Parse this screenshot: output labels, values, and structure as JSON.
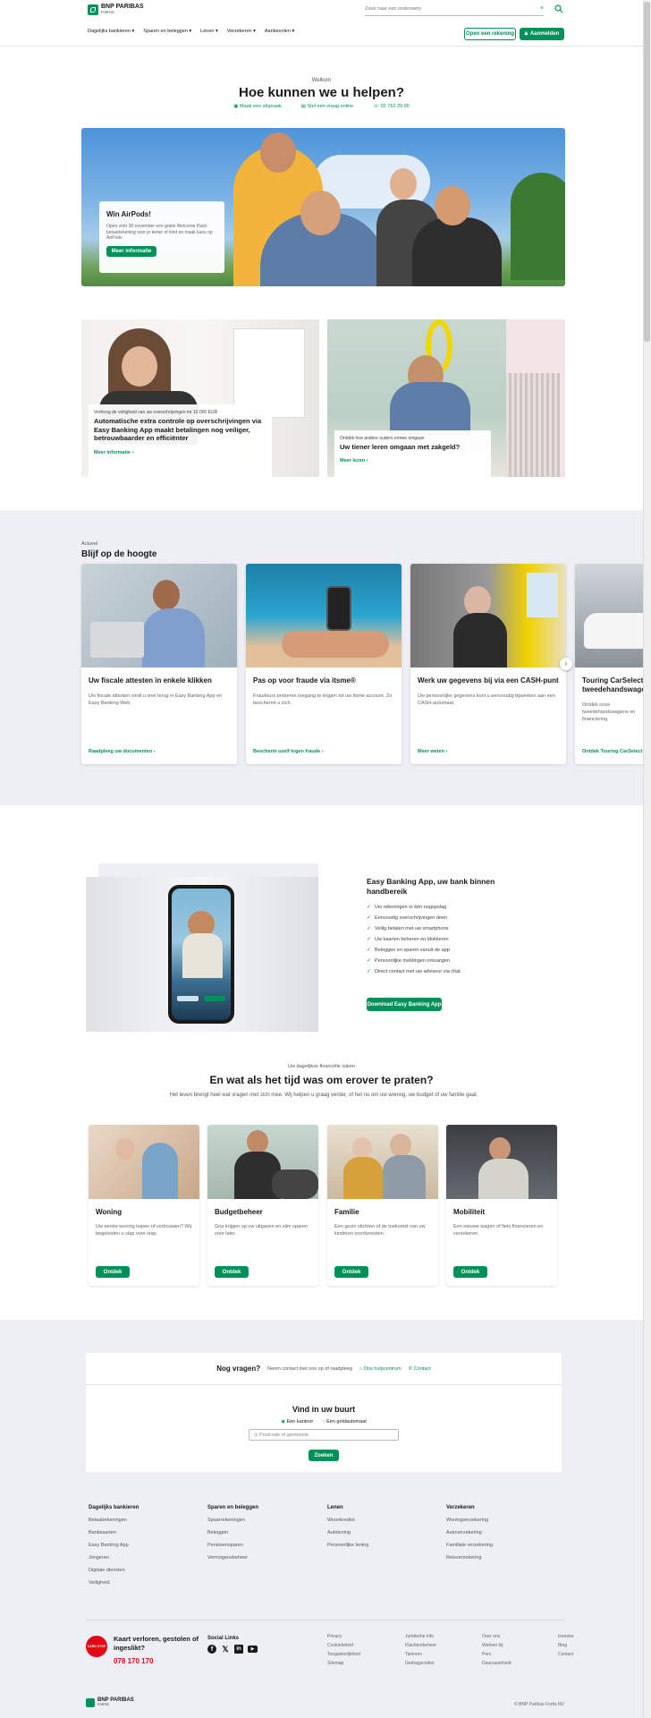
{
  "header": {
    "logo_name": "BNP PARIBAS",
    "logo_sub": "FORTIS",
    "search_placeholder": "Zoek naar een onderwerp",
    "nav": [
      "Dagelijks bankieren",
      "Sparen en beleggen",
      "Lenen",
      "Verzekeren",
      "Aanbevolen"
    ],
    "open_account": "Open een rekening",
    "login": "Aanmelden"
  },
  "help": {
    "eyebrow": "Welkom",
    "title": "Hoe kunnen we u helpen?",
    "links": [
      "Maak een afspraak",
      "Stel een vraag online",
      "02 762 20 00"
    ]
  },
  "hero": {
    "title": "Win AirPods!",
    "text": "Open vóór 30 november een gratis Welcome Pack-betaalrekening voor je tiener of kind en maak kans op AirPods.",
    "button": "Meer informatie"
  },
  "promos": [
    {
      "small": "Verhoog de veiligheid van uw overschrijvingen tot 10.000 EUR",
      "title": "Automatische extra controle op overschrijvingen via Easy Banking App maakt betalingen nog veiliger, betrouwbaarder en efficiënter",
      "link": "Meer informatie"
    },
    {
      "small": "Ontdek hoe andere ouders ermee omgaan",
      "title": "Uw tiener leren omgaan met zakgeld?",
      "link": "Meer lezen"
    }
  ],
  "updates": {
    "eyebrow": "Actueel",
    "title": "Blijf op de hoogte",
    "cards": [
      {
        "title": "Uw fiscale attesten in enkele klikken",
        "text": "Uw fiscale attesten vindt u snel terug in Easy Banking App en Easy Banking Web.",
        "link": "Raadpleeg uw documenten"
      },
      {
        "title": "Pas op voor fraude via itsme®",
        "text": "Fraudeurs proberen toegang te krijgen tot uw itsme-account. Zo beschermt u zich.",
        "link": "Bescherm uzelf tegen fraude"
      },
      {
        "title": "Werk uw gegevens bij via een CASH-punt",
        "text": "Uw persoonlijke gegevens kunt u eenvoudig bijwerken aan een CASH-automaat.",
        "link": "Meer weten"
      },
      {
        "title": "Touring CarSelect, tweedehandswage",
        "text": "Ontdek onze tweedehandswagens en financiering.",
        "link": "Ontdek Touring CarSelect"
      }
    ]
  },
  "app": {
    "title": "Easy Banking App, uw bank binnen handbereik",
    "features": [
      "Uw rekeningen in één oogopslag",
      "Eenvoudig overschrijvingen doen",
      "Veilig betalen met uw smartphone",
      "Uw kaarten beheren en blokkeren",
      "Beleggen en sparen vanuit de app",
      "Persoonlijke meldingen ontvangen",
      "Direct contact met uw adviseur via chat"
    ],
    "button": "Download Easy Banking App"
  },
  "life": {
    "eyebrow": "Uw dagelijkse financiële zaken",
    "title": "En wat als het tijd was om erover te praten?",
    "subtitle": "Het leven brengt heel wat vragen met zich mee. Wij helpen u graag verder, of het nu om uw woning, uw budget of uw familie gaat.",
    "cards": [
      {
        "title": "Woning",
        "text": "Uw eerste woning kopen of verbouwen? Wij begeleiden u stap voor stap.",
        "button": "Ontdek"
      },
      {
        "title": "Budgetbeheer",
        "text": "Grip krijgen op uw uitgaven en slim sparen voor later.",
        "button": "Ontdek"
      },
      {
        "title": "Familie",
        "text": "Een gezin stichten of de toekomst van uw kinderen voorbereiden.",
        "button": "Ontdek"
      },
      {
        "title": "Mobiliteit",
        "text": "Een nieuwe wagen of fiets financieren en verzekeren.",
        "button": "Ontdek"
      }
    ]
  },
  "questions": {
    "label": "Nog vragen?",
    "text": "Neem contact met ons op of raadpleeg",
    "link1": "Ons hulpcentrum",
    "link2": "Contact"
  },
  "locator": {
    "title": "Vind in uw buurt",
    "opt1": "Een kantoor",
    "opt2": "Een geldautomaat",
    "placeholder": "Postcode of gemeente",
    "button": "Zoeken"
  },
  "footer": {
    "cols": [
      {
        "title": "Dagelijks bankieren",
        "items": [
          "Betaalrekeningen",
          "Bankkaarten",
          "Easy Banking App",
          "Jongeren",
          "Digitale diensten",
          "Veiligheid"
        ]
      },
      {
        "title": "Sparen en beleggen",
        "items": [
          "Spaarrekeningen",
          "Beleggen",
          "Pensioensparen",
          "Vermogensbeheer"
        ]
      },
      {
        "title": "Lenen",
        "items": [
          "Woonkrediet",
          "Autolening",
          "Persoonlijke lening"
        ]
      },
      {
        "title": "Verzekeren",
        "items": [
          "Woningverzekering",
          "Autoverzekering",
          "Familiale verzekering",
          "Reisverzekering"
        ]
      }
    ],
    "lost_title": "Kaart verloren, gestolen of ingeslikt?",
    "lost_phone": "078 170 170",
    "lost_badge": "CARD STOP",
    "social_title": "Social Links",
    "links": [
      [
        "Privacy",
        "Cookiebeleid",
        "Toegankelijkheid",
        "Sitemap"
      ],
      [
        "Juridische info",
        "Klachtenbeheer",
        "Tarieven",
        "Gedragscodes"
      ],
      [
        "Over ons",
        "Werken bij",
        "Pers",
        "Duurzaamheid"
      ],
      [
        "Investor",
        "Blog",
        "Contact"
      ]
    ],
    "copyright": "© BNP Paribas Fortis NV"
  },
  "colors": {
    "brand": "#00915a",
    "bg_grey": "#edeff4"
  }
}
